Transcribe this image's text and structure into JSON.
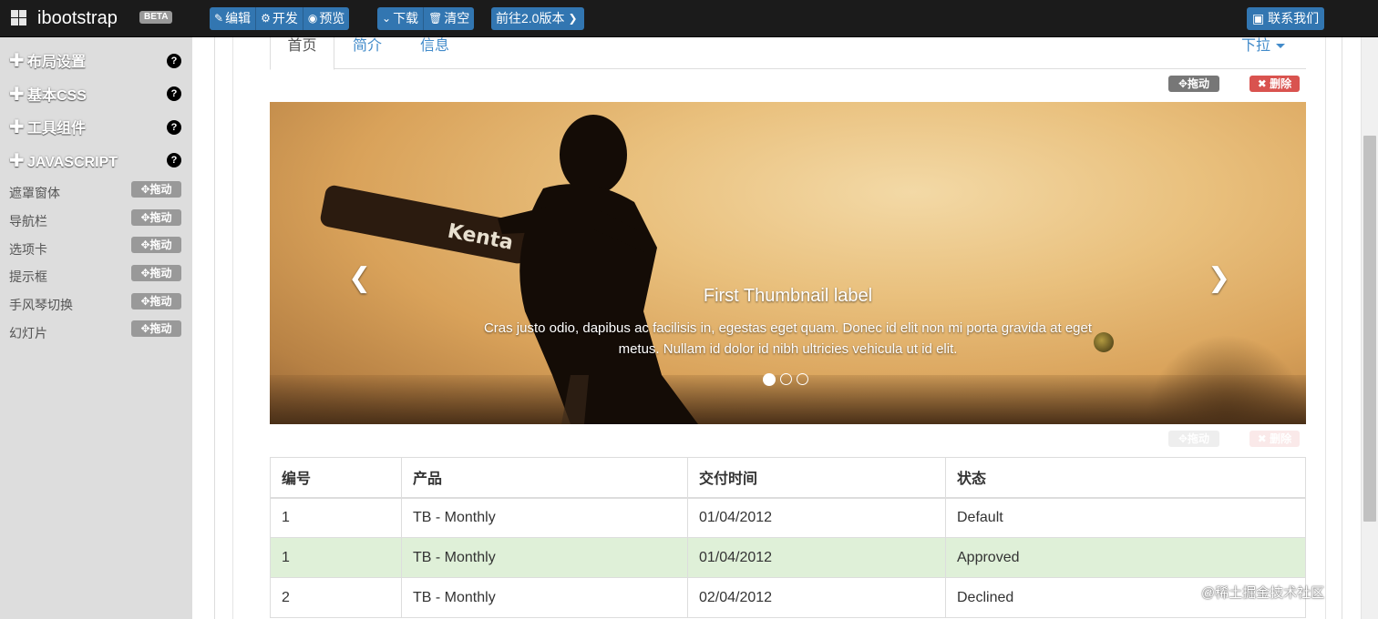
{
  "navbar": {
    "brand": "ibootstrap",
    "beta": "BETA",
    "group1": [
      {
        "icon": "✎",
        "label": "编辑"
      },
      {
        "icon": "⚙",
        "label": "开发"
      },
      {
        "icon": "◉",
        "label": "预览"
      }
    ],
    "group2": [
      {
        "icon": "⌄",
        "label": "下载"
      },
      {
        "icon": "🗑",
        "label": "清空"
      }
    ],
    "version_button": "前往2.0版本",
    "version_icon": "❯",
    "contact_icon": "▣",
    "contact": "联系我们"
  },
  "sidebar": {
    "sections": [
      {
        "label": "布局设置",
        "help": "?"
      },
      {
        "label": "基本CSS",
        "help": "?"
      },
      {
        "label": "工具组件",
        "help": "?"
      },
      {
        "label": "JAVASCRIPT",
        "help": "?"
      }
    ],
    "plus": "✚",
    "components": [
      {
        "label": "遮罩窗体",
        "drag": "✥拖动"
      },
      {
        "label": "导航栏",
        "drag": "✥拖动"
      },
      {
        "label": "选项卡",
        "drag": "✥拖动"
      },
      {
        "label": "提示框",
        "drag": "✥拖动"
      },
      {
        "label": "手风琴切换",
        "drag": "✥拖动"
      },
      {
        "label": "幻灯片",
        "drag": "✥拖动"
      }
    ]
  },
  "tabs": {
    "items": [
      "首页",
      "简介",
      "信息"
    ],
    "dropdown": "下拉"
  },
  "labels": {
    "drag": "✥拖动",
    "delete": "✖ 删除"
  },
  "carousel": {
    "prev": "❮",
    "next": "❯",
    "title": "First Thumbnail label",
    "text": "Cras justo odio, dapibus ac facilisis in, egestas eget quam. Donec id elit non mi porta gravida at eget metus. Nullam id dolor id nibh ultricies vehicula ut id elit.",
    "bat_text": "Kenta",
    "slide_count": 3,
    "active_slide": 1
  },
  "table": {
    "headers": [
      "编号",
      "产品",
      "交付时间",
      "状态"
    ],
    "rows": [
      {
        "cells": [
          "1",
          "TB - Monthly",
          "01/04/2012",
          "Default"
        ],
        "style": ""
      },
      {
        "cells": [
          "1",
          "TB - Monthly",
          "01/04/2012",
          "Approved"
        ],
        "style": "success"
      },
      {
        "cells": [
          "2",
          "TB - Monthly",
          "02/04/2012",
          "Declined"
        ],
        "style": ""
      }
    ]
  },
  "watermark": "@稀土掘金技术社区",
  "colors": {
    "primary": "#3276b1",
    "danger": "#d9534f",
    "success_row": "#dff0d8",
    "sidebar": "#dddddd"
  }
}
